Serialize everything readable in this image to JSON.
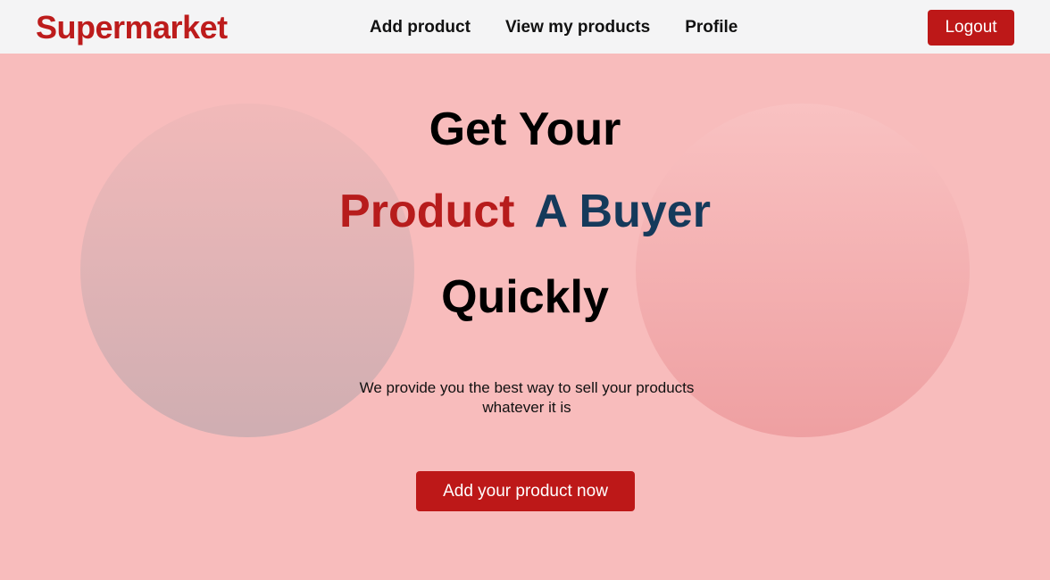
{
  "navbar": {
    "brand": "Supermarket",
    "links": [
      {
        "label": "Add product"
      },
      {
        "label": "View my products"
      },
      {
        "label": "Profile"
      }
    ],
    "logout_label": "Logout"
  },
  "hero": {
    "line1": "Get Your",
    "line2_word1": "Product",
    "line2_word2": "A Buyer",
    "line3": "Quickly",
    "subtitle": "We provide you the best way to sell your products whatever it is",
    "cta_label": "Add your product now"
  },
  "colors": {
    "brand_red": "#bd1c1c",
    "navy": "#153a5b",
    "hero_background": "#f8bcbc",
    "navbar_background": "#f4f4f5"
  }
}
